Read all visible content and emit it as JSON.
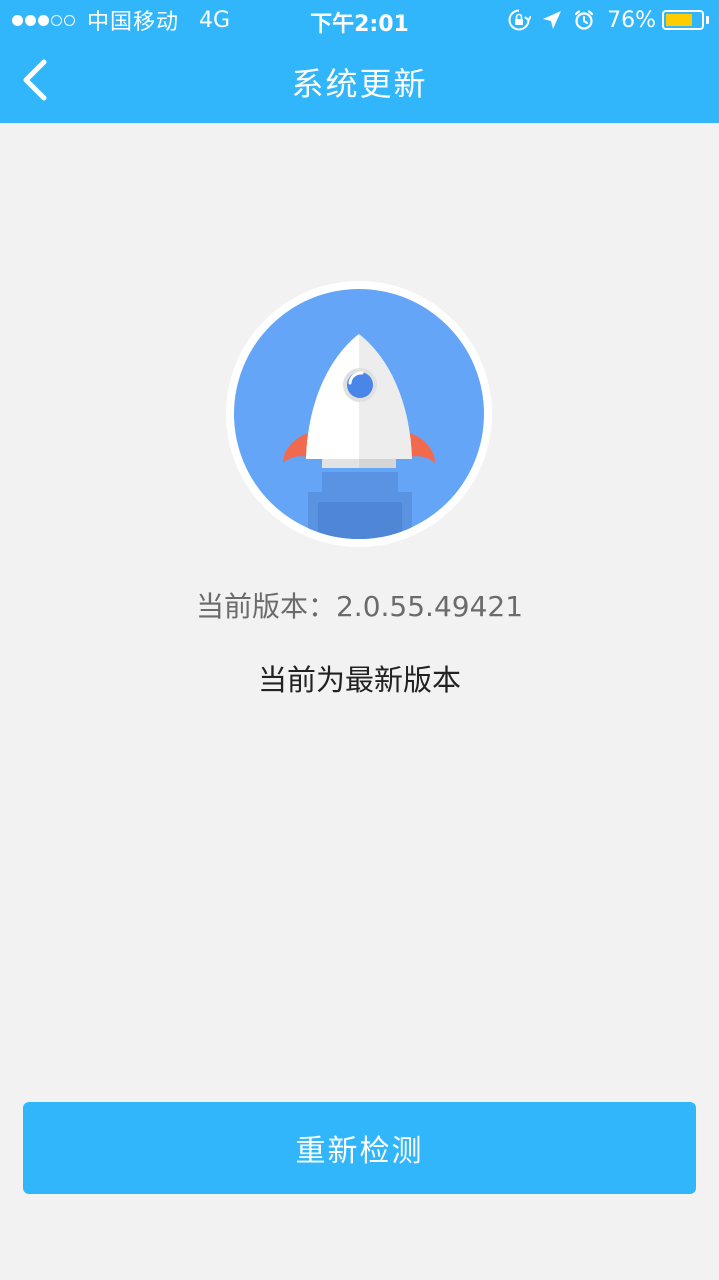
{
  "status_bar": {
    "signal_strength": "3 of 5",
    "carrier": "中国移动",
    "network": "4G",
    "time": "下午2:01",
    "battery_percent": "76%",
    "battery_level": 0.76,
    "icons": [
      "orientation-lock-icon",
      "location-arrow-icon",
      "alarm-clock-icon"
    ]
  },
  "nav": {
    "title": "系统更新",
    "back_icon": "chevron-left-icon"
  },
  "main": {
    "illustration": "rocket-icon",
    "version_label": "当前版本：",
    "version_value": "2.0.55.49421",
    "status_text": "当前为最新版本"
  },
  "footer": {
    "recheck_label": "重新检测"
  },
  "colors": {
    "accent": "#31b6fb",
    "background": "#f2f2f2",
    "rocket_circle": "#64a5f8",
    "rocket_flame": "#f26a4e",
    "battery": "#ffcc00"
  }
}
